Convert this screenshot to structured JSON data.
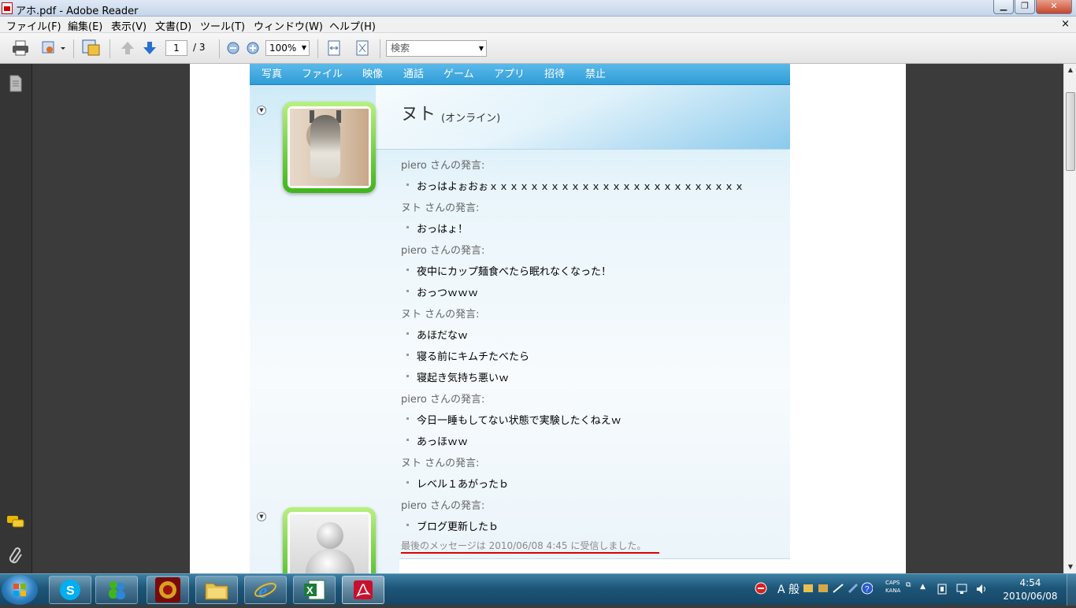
{
  "window": {
    "title": "アホ.pdf - Adobe Reader",
    "min_glyph": "▁",
    "max_glyph": "❐",
    "close_glyph": "✕"
  },
  "menu": {
    "items": [
      "ファイル(F)",
      "編集(E)",
      "表示(V)",
      "文書(D)",
      "ツール(T)",
      "ウィンドウ(W)",
      "ヘルプ(H)"
    ],
    "close_glyph": "×"
  },
  "toolbar": {
    "page_current": "1",
    "page_total": "/ 3",
    "zoom": "100%",
    "search_placeholder": "検索"
  },
  "messenger": {
    "tabs": [
      "写真",
      "ファイル",
      "映像",
      "通話",
      "ゲーム",
      "アプリ",
      "招待",
      "禁止"
    ],
    "contact_name": "ヌト",
    "contact_status": "(オンライン)",
    "conversation": [
      {
        "type": "sender",
        "text": "piero さんの発言:"
      },
      {
        "type": "msg",
        "text": "おっはよぉおぉｘｘｘｘｘｘｘｘｘｘｘｘｘｘｘｘｘｘｘｘｘｘｘｘｘ"
      },
      {
        "type": "sender",
        "text": "ヌト さんの発言:"
      },
      {
        "type": "msg",
        "text": "おっはょ！"
      },
      {
        "type": "sender",
        "text": "piero さんの発言:"
      },
      {
        "type": "msg",
        "text": "夜中にカップ麺食べたら眠れなくなった！"
      },
      {
        "type": "msg",
        "text": "おっつｗｗｗ"
      },
      {
        "type": "sender",
        "text": "ヌト さんの発言:"
      },
      {
        "type": "msg",
        "text": "あほだなｗ"
      },
      {
        "type": "msg",
        "text": "寝る前にキムチたべたら"
      },
      {
        "type": "msg",
        "text": "寝起き気持ち悪いｗ"
      },
      {
        "type": "sender",
        "text": "piero さんの発言:"
      },
      {
        "type": "msg",
        "text": "今日一睡もしてない状態で実験したくねえｗ"
      },
      {
        "type": "msg",
        "text": "あっほｗｗ"
      },
      {
        "type": "sender",
        "text": "ヌト さんの発言:"
      },
      {
        "type": "msg",
        "text": "レベル１あがったｂ"
      },
      {
        "type": "sender",
        "text": "piero さんの発言:"
      },
      {
        "type": "msg",
        "text": "ブログ更新したｂ"
      }
    ],
    "last_message": "最後のメッセージは 2010/06/08 4:45 に受信しました。",
    "accent_color": "#e00000"
  },
  "taskbar": {
    "ime_mode": "A 般",
    "caps": "CAPS",
    "kana": "KANA",
    "time": "4:54",
    "date": "2010/06/08"
  }
}
